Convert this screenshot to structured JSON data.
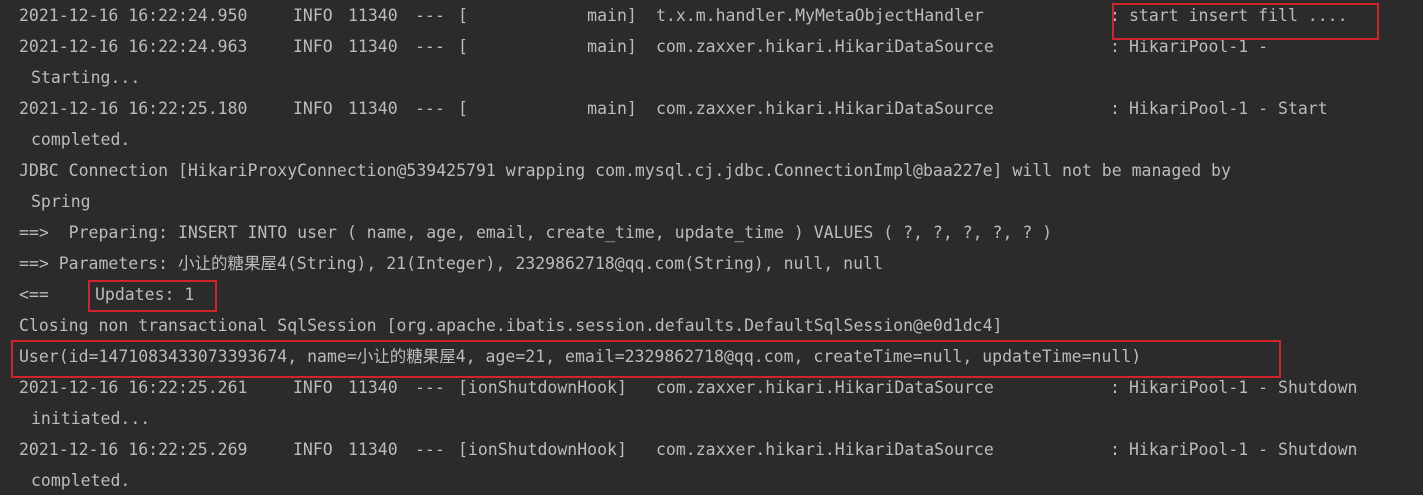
{
  "console": {
    "colors": {
      "background": "#2b2b2b",
      "text": "#bbbbbb",
      "highlight": "#d0232a"
    },
    "lines": [
      {
        "ts": "2021-12-16 16:22:24.950",
        "level": "INFO",
        "pid": "11340",
        "sep": "---",
        "thread": "[            main]",
        "logger": "t.x.m.handler.MyMetaObjectHandler",
        "colon": ":",
        "message": "start insert fill ...."
      },
      {
        "ts": "2021-12-16 16:22:24.963",
        "level": "INFO",
        "pid": "11340",
        "sep": "---",
        "thread": "[            main]",
        "logger": "com.zaxxer.hikari.HikariDataSource",
        "colon": ":",
        "message": "HikariPool-1 -",
        "cont": "Starting..."
      },
      {
        "ts": "2021-12-16 16:22:25.180",
        "level": "INFO",
        "pid": "11340",
        "sep": "---",
        "thread": "[            main]",
        "logger": "com.zaxxer.hikari.HikariDataSource",
        "colon": ":",
        "message": "HikariPool-1 - Start",
        "cont": "completed."
      },
      {
        "text": "JDBC Connection [HikariProxyConnection@539425791 wrapping com.mysql.cj.jdbc.ConnectionImpl@baa227e] will not be managed by",
        "cont": "Spring"
      },
      {
        "text": "==>  Preparing: INSERT INTO user ( name, age, email, create_time, update_time ) VALUES ( ?, ?, ?, ?, ? )"
      },
      {
        "text": "==> Parameters: 小让的糖果屋4(String), 21(Integer), 2329862718@qq.com(String), null, null"
      },
      {
        "arrow": "<==",
        "updates": "Updates: 1"
      },
      {
        "text": "Closing non transactional SqlSession [org.apache.ibatis.session.defaults.DefaultSqlSession@e0d1dc4]"
      },
      {
        "text": "User(id=1471083433073393674, name=小让的糖果屋4, age=21, email=2329862718@qq.com, createTime=null, updateTime=null)"
      },
      {
        "ts": "2021-12-16 16:22:25.261",
        "level": "INFO",
        "pid": "11340",
        "sep": "---",
        "thread": "[ionShutdownHook]",
        "logger": "com.zaxxer.hikari.HikariDataSource",
        "colon": ":",
        "message": "HikariPool-1 - Shutdown",
        "cont": "initiated..."
      },
      {
        "ts": "2021-12-16 16:22:25.269",
        "level": "INFO",
        "pid": "11340",
        "sep": "---",
        "thread": "[ionShutdownHook]",
        "logger": "com.zaxxer.hikari.HikariDataSource",
        "colon": ":",
        "message": "HikariPool-1 - Shutdown",
        "cont": "completed."
      }
    ]
  }
}
